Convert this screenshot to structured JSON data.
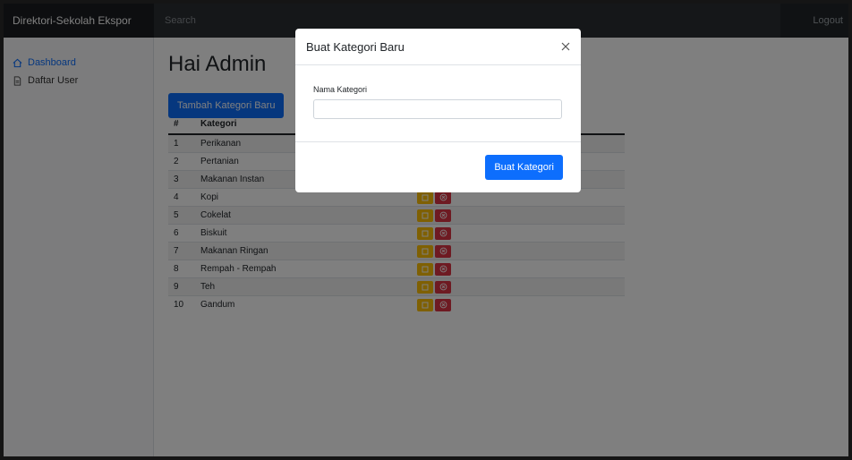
{
  "app": {
    "brand": "Direktori-Sekolah Ekspor",
    "search_placeholder": "Search",
    "signout": "Logout"
  },
  "sidebar": {
    "items": [
      {
        "label": "Dashboard",
        "icon": "home-icon",
        "active": true
      },
      {
        "label": "Daftar User",
        "icon": "file-icon",
        "active": false
      }
    ]
  },
  "main": {
    "title": "Hai Admin",
    "add_button": "Tambah Kategori Baru",
    "table": {
      "headers": [
        "#",
        "Kategori",
        ""
      ],
      "rows": [
        {
          "num": "1",
          "name": "Perikanan"
        },
        {
          "num": "2",
          "name": "Pertanian"
        },
        {
          "num": "3",
          "name": "Makanan Instan"
        },
        {
          "num": "4",
          "name": "Kopi"
        },
        {
          "num": "5",
          "name": "Cokelat"
        },
        {
          "num": "6",
          "name": "Biskuit"
        },
        {
          "num": "7",
          "name": "Makanan Ringan"
        },
        {
          "num": "8",
          "name": "Rempah - Rempah"
        },
        {
          "num": "9",
          "name": "Teh"
        },
        {
          "num": "10",
          "name": "Gandum"
        }
      ]
    }
  },
  "modal": {
    "title": "Buat Kategori Baru",
    "field_label": "Nama Kategori",
    "field_value": "",
    "submit": "Buat Kategori"
  },
  "colors": {
    "primary": "#0d6efd",
    "warning": "#ffc107",
    "danger": "#dc3545",
    "topbar": "#212529"
  }
}
